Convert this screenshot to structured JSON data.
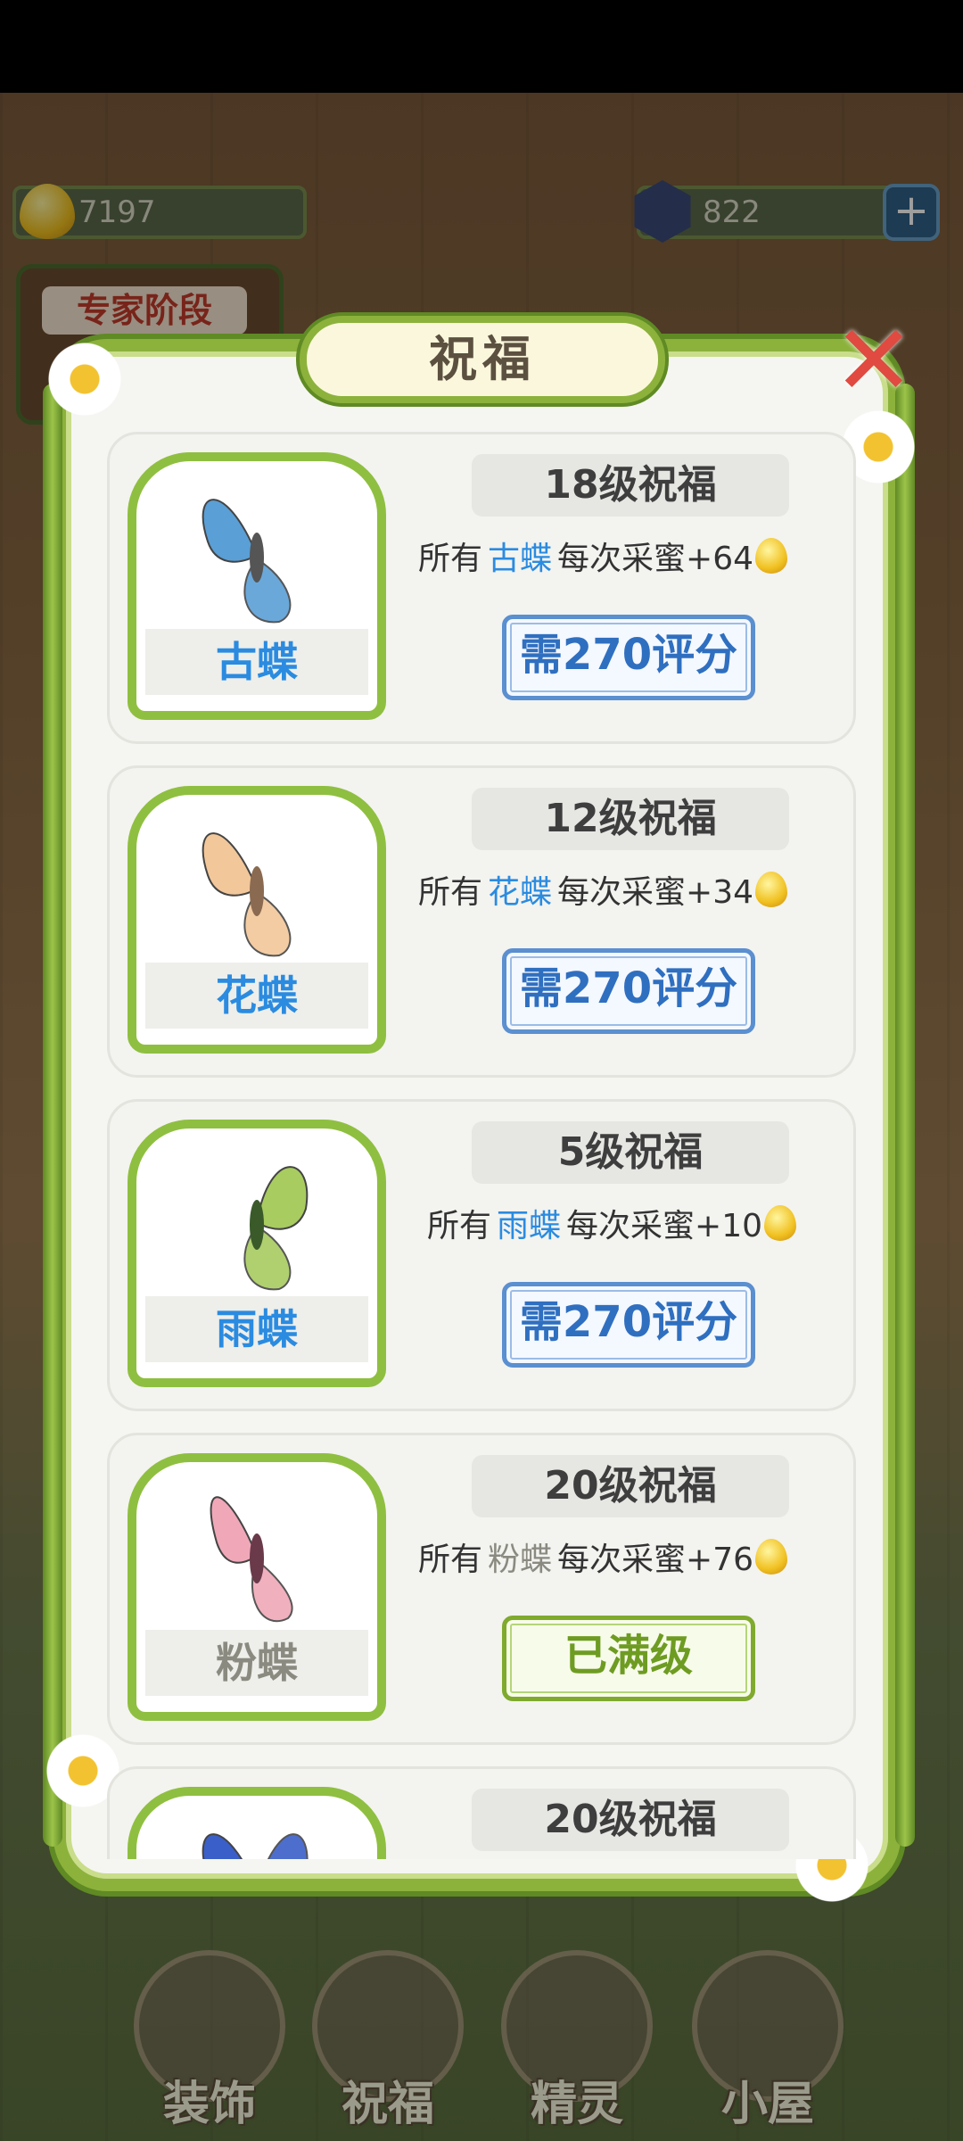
{
  "top_bar": {
    "honey_count": "7197",
    "gem_count": "822",
    "add_label": "+",
    "stage_badge": "专家阶段"
  },
  "dialog": {
    "title": "祝福",
    "close_label": "✕"
  },
  "blessings": [
    {
      "level_label": "18级祝福",
      "desc_prefix": "所有",
      "butterfly": "古蝶",
      "desc_suffix": "每次采蜜+64",
      "button": "需270评分",
      "button_state": "required",
      "wing_color": "#5a9fd6",
      "name_color": "#2a8be0"
    },
    {
      "level_label": "12级祝福",
      "desc_prefix": "所有",
      "butterfly": "花蝶",
      "desc_suffix": "每次采蜜+34",
      "button": "需270评分",
      "button_state": "required",
      "wing_color": "#f2c79a",
      "name_color": "#2a8be0"
    },
    {
      "level_label": "5级祝福",
      "desc_prefix": "所有",
      "butterfly": "雨蝶",
      "desc_suffix": "每次采蜜+10",
      "button": "需270评分",
      "button_state": "required",
      "wing_color": "#a8cc60",
      "name_color": "#2a8be0"
    },
    {
      "level_label": "20级祝福",
      "desc_prefix": "所有",
      "butterfly": "粉蝶",
      "desc_suffix": "每次采蜜+76",
      "button": "已满级",
      "button_state": "maxed",
      "wing_color": "#f0a8b8",
      "name_color": "#8a8a80"
    },
    {
      "level_label": "20级祝福",
      "desc_prefix": "",
      "butterfly": "",
      "desc_suffix": "",
      "button": "",
      "button_state": "partial",
      "wing_color": "#3a5fc8",
      "name_color": "#2a8be0"
    }
  ],
  "bottom_nav": [
    {
      "label": "装饰"
    },
    {
      "label": "祝福"
    },
    {
      "label": "精灵"
    },
    {
      "label": "小屋"
    }
  ]
}
